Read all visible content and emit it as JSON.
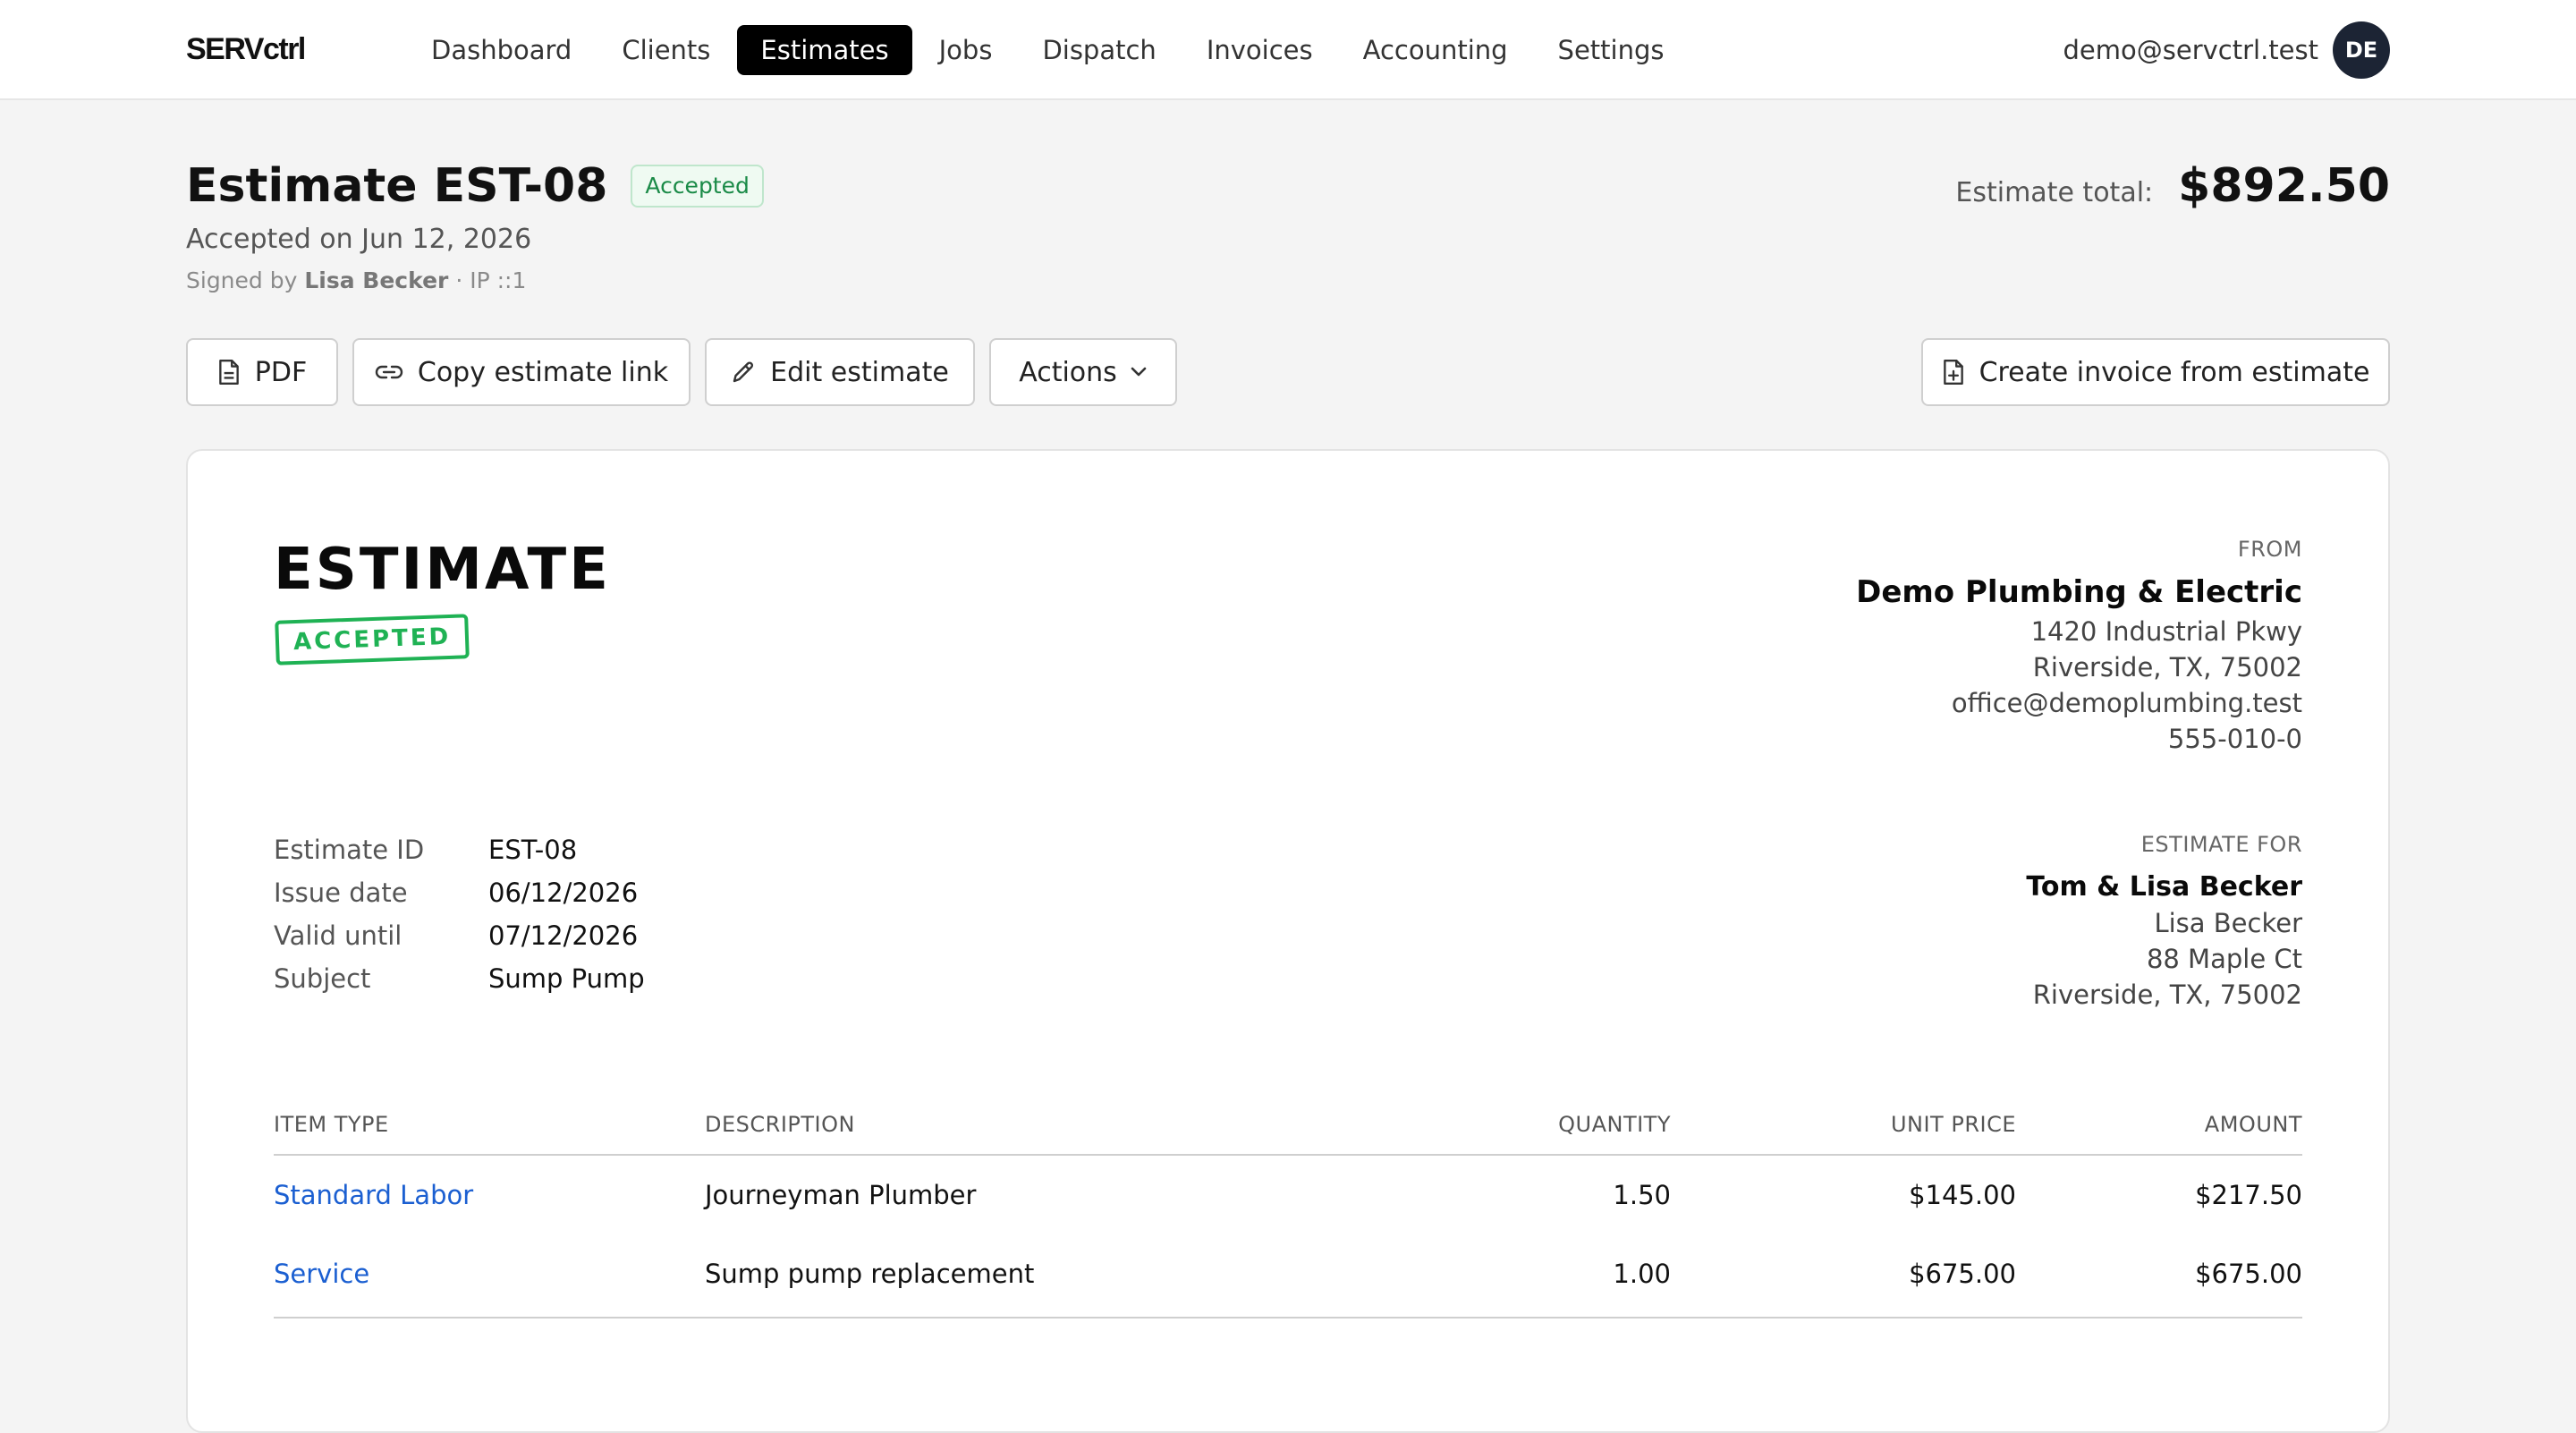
{
  "nav": {
    "logo": "SERVctrl",
    "links": [
      {
        "label": "Dashboard",
        "active": false
      },
      {
        "label": "Clients",
        "active": false
      },
      {
        "label": "Estimates",
        "active": true
      },
      {
        "label": "Jobs",
        "active": false
      },
      {
        "label": "Dispatch",
        "active": false
      },
      {
        "label": "Invoices",
        "active": false
      },
      {
        "label": "Accounting",
        "active": false
      },
      {
        "label": "Settings",
        "active": false
      }
    ],
    "user_email": "demo@servctrl.test",
    "avatar_initials": "DE"
  },
  "header": {
    "title": "Estimate EST-08",
    "status": "Accepted",
    "accepted_on": "Accepted on Jun 12, 2026",
    "signed_prefix": "Signed by",
    "signed_name": "Lisa Becker",
    "signed_suffix": "· IP ::1",
    "total_label": "Estimate total:",
    "total_value": "$892.50"
  },
  "actions": {
    "pdf": "PDF",
    "copy_link": "Copy estimate link",
    "edit": "Edit estimate",
    "actions_menu": "Actions",
    "create_invoice": "Create invoice from estimate"
  },
  "document": {
    "title": "ESTIMATE",
    "stamp": "ACCEPTED",
    "from": {
      "label": "FROM",
      "name": "Demo Plumbing & Electric",
      "lines": [
        "1420 Industrial Pkwy",
        "Riverside, TX, 75002",
        "office@demoplumbing.test",
        "555-010-0"
      ]
    },
    "meta": [
      {
        "key": "Estimate ID",
        "value": "EST-08"
      },
      {
        "key": "Issue date",
        "value": "06/12/2026"
      },
      {
        "key": "Valid until",
        "value": "07/12/2026"
      },
      {
        "key": "Subject",
        "value": "Sump Pump"
      }
    ],
    "estimate_for": {
      "label": "ESTIMATE FOR",
      "name": "Tom & Lisa Becker",
      "lines": [
        "Lisa Becker",
        "88 Maple Ct",
        "Riverside, TX, 75002"
      ]
    },
    "table": {
      "headers": [
        "ITEM TYPE",
        "DESCRIPTION",
        "QUANTITY",
        "UNIT PRICE",
        "AMOUNT"
      ],
      "rows": [
        {
          "type": "Standard Labor",
          "description": "Journeyman Plumber",
          "quantity": "1.50",
          "unit_price": "$145.00",
          "amount": "$217.50"
        },
        {
          "type": "Service",
          "description": "Sump pump replacement",
          "quantity": "1.00",
          "unit_price": "$675.00",
          "amount": "$675.00"
        }
      ]
    }
  },
  "colors": {
    "accent": "#000000",
    "accepted_green": "#1fb254",
    "link_blue": "#1b5fd1",
    "avatar_bg": "#1c2434"
  }
}
